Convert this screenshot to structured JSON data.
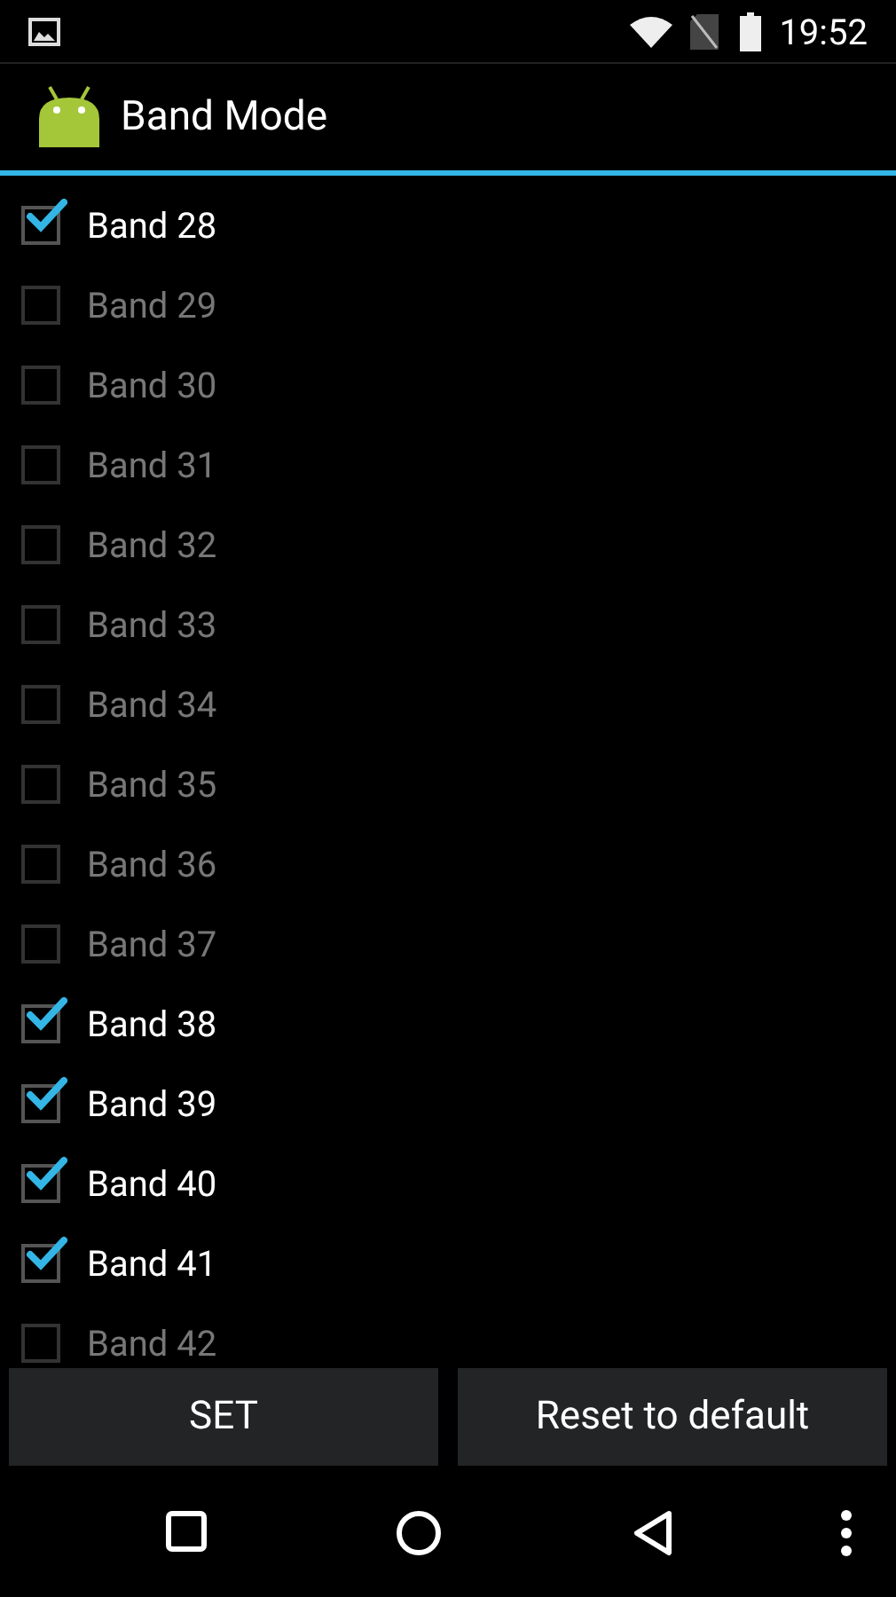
{
  "status_bar": {
    "time": "19:52"
  },
  "action_bar": {
    "title": "Band Mode"
  },
  "bands": [
    {
      "label": "Band 28",
      "checked": true
    },
    {
      "label": "Band 29",
      "checked": false
    },
    {
      "label": "Band 30",
      "checked": false
    },
    {
      "label": "Band 31",
      "checked": false
    },
    {
      "label": "Band 32",
      "checked": false
    },
    {
      "label": "Band 33",
      "checked": false
    },
    {
      "label": "Band 34",
      "checked": false
    },
    {
      "label": "Band 35",
      "checked": false
    },
    {
      "label": "Band 36",
      "checked": false
    },
    {
      "label": "Band 37",
      "checked": false
    },
    {
      "label": "Band 38",
      "checked": true
    },
    {
      "label": "Band 39",
      "checked": true
    },
    {
      "label": "Band 40",
      "checked": true
    },
    {
      "label": "Band 41",
      "checked": true
    },
    {
      "label": "Band 42",
      "checked": false
    }
  ],
  "buttons": [
    "SET",
    "Reset to default"
  ]
}
